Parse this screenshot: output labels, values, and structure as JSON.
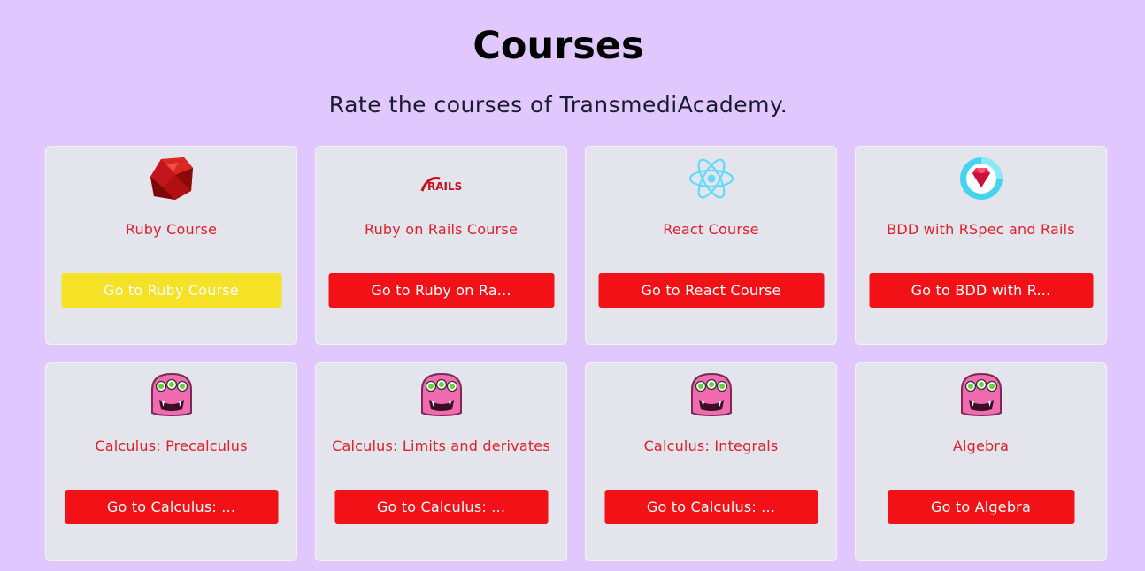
{
  "header": {
    "title": "Courses",
    "subtitle": "Rate the courses of TransmediAcademy."
  },
  "colors": {
    "background": "#e0c8ff",
    "card": "#e4e4ec",
    "accent_red": "#f21116",
    "title_red": "#e0202a",
    "active_yellow": "#f5e126"
  },
  "courses": [
    {
      "icon": "ruby-gem-icon",
      "title": "Ruby Course",
      "button": "Go to Ruby Course",
      "active": true
    },
    {
      "icon": "rails-logo-icon",
      "title": "Ruby on Rails Course",
      "button": "Go to Ruby on Ra...",
      "active": false
    },
    {
      "icon": "react-atom-icon",
      "title": "React Course",
      "button": "Go to React Course",
      "active": false
    },
    {
      "icon": "rspec-gem-icon",
      "title": "BDD with RSpec and Rails",
      "button": "Go to BDD with R...",
      "active": false
    },
    {
      "icon": "monster-icon",
      "title": "Calculus: Precalculus",
      "button": "Go to Calculus: ...",
      "active": false
    },
    {
      "icon": "monster-icon",
      "title": "Calculus: Limits and derivates",
      "button": "Go to Calculus: ...",
      "active": false
    },
    {
      "icon": "monster-icon",
      "title": "Calculus: Integrals",
      "button": "Go to Calculus: ...",
      "active": false
    },
    {
      "icon": "monster-icon",
      "title": "Algebra",
      "button": "Go to Algebra",
      "active": false
    }
  ],
  "icons": {
    "rails_text": "RAILS"
  }
}
